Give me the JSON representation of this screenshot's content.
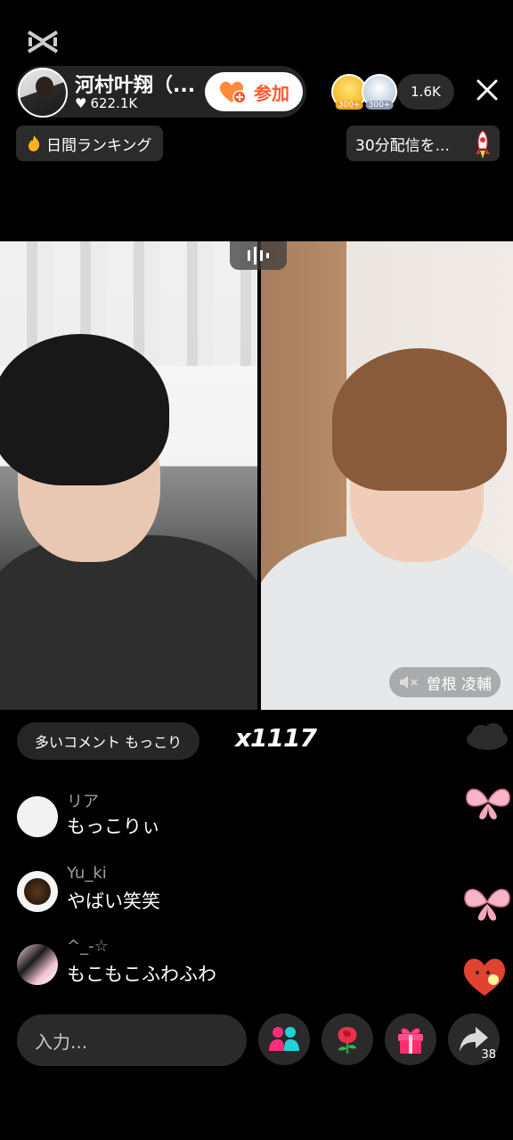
{
  "host": {
    "name": "河村叶翔（...",
    "likes": "622.1K",
    "join_label": "参加"
  },
  "viewers": {
    "badges": [
      "300+",
      "300+"
    ],
    "count": "1.6K"
  },
  "tags": {
    "ranking": "日間ランキング",
    "stream_goal": "30分配信を..."
  },
  "guest": {
    "name": "曽根 凌輔"
  },
  "top_comment": {
    "label": "多いコメント もっこり",
    "combo": "x1117"
  },
  "comments": [
    {
      "user": "リア",
      "text": "もっこりぃ"
    },
    {
      "user": "Yu_ki",
      "text": "やばい笑笑"
    },
    {
      "user": "^_-☆",
      "text": "もこもこふわふわ"
    }
  ],
  "bottom_bar": {
    "input_placeholder": "入力...",
    "share_count": "38"
  },
  "colors": {
    "accent": "#ff5a2e",
    "background": "#000000",
    "pill": "#2a2a2a"
  }
}
